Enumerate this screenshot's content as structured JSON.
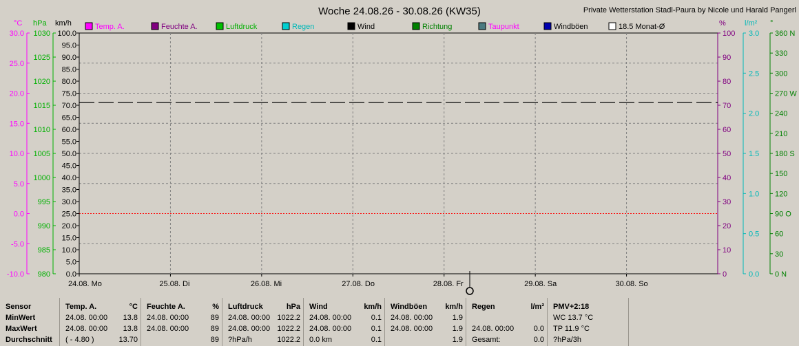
{
  "title": "Woche 24.08.26 - 30.08.26 (KW35)",
  "station": "Private Wetterstation Stadl-Paura by Nicole und Harald Pangerl",
  "legend": [
    {
      "label": "Temp. A.",
      "box": "#ff00ff",
      "text": "#ff00ff"
    },
    {
      "label": "Feuchte A.",
      "box": "#800080",
      "text": "#800080"
    },
    {
      "label": "Luftdruck",
      "box": "#00c000",
      "text": "#00b000"
    },
    {
      "label": "Regen",
      "box": "#00d0d0",
      "text": "#00b8b8"
    },
    {
      "label": "Wind",
      "box": "#000000",
      "text": "#000000"
    },
    {
      "label": "Richtung",
      "box": "#008000",
      "text": "#008000"
    },
    {
      "label": "Taupunkt",
      "box": "#4c7a80",
      "text": "#ff00ff"
    },
    {
      "label": "Windböen",
      "box": "#0000b0",
      "text": "#000000"
    },
    {
      "label": "18.5 Monat-Ø",
      "box": "#ffffff",
      "text": "#000000"
    }
  ],
  "axis_units": {
    "temp": "°C",
    "pressure": "hPa",
    "wind": "km/h",
    "humidity": "%",
    "rain": "l/m²",
    "direction": "°"
  },
  "axes": {
    "temp": [
      "30.0",
      "25.0",
      "20.0",
      "15.0",
      "10.0",
      "5.0",
      "0.0",
      "-5.0",
      "-10.0"
    ],
    "pressure": [
      "1030",
      "1025",
      "1020",
      "1015",
      "1010",
      "1005",
      "1000",
      "995",
      "990",
      "985",
      "980"
    ],
    "wind": [
      "100.0",
      "95.0",
      "90.0",
      "85.0",
      "80.0",
      "75.0",
      "70.0",
      "65.0",
      "60.0",
      "55.0",
      "50.0",
      "45.0",
      "40.0",
      "35.0",
      "30.0",
      "25.0",
      "20.0",
      "15.0",
      "10.0",
      "5.0",
      "0.0"
    ],
    "humidity": [
      "100",
      "90",
      "80",
      "70",
      "60",
      "50",
      "40",
      "30",
      "20",
      "10",
      "0"
    ],
    "rain": [
      "3.0",
      "2.5",
      "2.0",
      "1.5",
      "1.0",
      "0.5",
      "0.0"
    ],
    "direction": [
      "360 N",
      "330",
      "300",
      "270 W",
      "240",
      "210",
      "180 S",
      "150",
      "120",
      "90 O",
      "60",
      "30",
      "0  N"
    ]
  },
  "days": [
    "24.08.  Mo",
    "25.08.  Di",
    "26.08.  Mi",
    "27.08.  Do",
    "28.08.  Fr",
    "29.08.  Sa",
    "30.08.  So"
  ],
  "colors": {
    "temp": "#ff00ff",
    "pressure": "#00b000",
    "humidity": "#800080",
    "rain": "#00b8b8",
    "direction": "#008000",
    "zero_line": "#ff0000"
  },
  "chart_data": {
    "type": "line",
    "title": "Woche 24.08.26 - 30.08.26 (KW35)",
    "x": [
      "24.08.",
      "25.08.",
      "26.08.",
      "27.08.",
      "28.08.",
      "29.08.",
      "30.08."
    ],
    "ylim_temp": [
      -10,
      30
    ],
    "ylim_pressure": [
      980,
      1030
    ],
    "ylim_wind": [
      0,
      100
    ],
    "ylim_humidity": [
      0,
      100
    ],
    "ylim_rain": [
      0,
      3
    ],
    "ylim_direction": [
      0,
      360
    ],
    "grid": true,
    "series": [
      {
        "name": "18.5 Monat-Ø",
        "axis": "temp",
        "values": [
          18.5,
          18.5,
          18.5,
          18.5,
          18.5,
          18.5,
          18.5,
          18.5
        ],
        "style": "dashed"
      }
    ],
    "zero_line_temp": 0
  },
  "stats": {
    "sensor": {
      "h": "Sensor",
      "min": "MinWert",
      "max": "MaxWert",
      "avg": "Durchschnitt"
    },
    "temp": {
      "h": "Temp. A.",
      "u": "°C",
      "min_t": "24.08.  00:00",
      "min_v": "13.8",
      "max_t": "24.08.  00:00",
      "max_v": "13.8",
      "avg_t": "( - 4.80 )",
      "avg_v": "13.70"
    },
    "hum": {
      "h": "Feuchte A.",
      "u": "%",
      "min_t": "24.08.  00:00",
      "min_v": "89",
      "max_t": "24.08.  00:00",
      "max_v": "89",
      "avg_t": "",
      "avg_v": "89"
    },
    "press": {
      "h": "Luftdruck",
      "u": "hPa",
      "min_t": "24.08.  00:00",
      "min_v": "1022.2",
      "max_t": "24.08.  00:00",
      "max_v": "1022.2",
      "avg_t": "?hPa/h",
      "avg_v": "1022.2"
    },
    "wind": {
      "h": "Wind",
      "u": "km/h",
      "min_t": "24.08.  00:00",
      "min_v": "0.1",
      "max_t": "24.08.  00:00",
      "max_v": "0.1",
      "avg_t": "0.0 km",
      "avg_v": "0.1"
    },
    "gust": {
      "h": "Windböen",
      "u": "km/h",
      "min_t": "24.08.  00:00",
      "min_v": "1.9",
      "max_t": "24.08.  00:00",
      "max_v": "1.9",
      "avg_t": "",
      "avg_v": "1.9"
    },
    "rain": {
      "h": "Regen",
      "u": "l/m²",
      "min_t": "",
      "min_v": "",
      "max_t": "24.08.  00:00",
      "max_v": "0.0",
      "avg_t": "Gesamt:",
      "avg_v": "0.0"
    },
    "pmv": {
      "h": "PMV+2:18",
      "min": "WC 13.7 °C",
      "max": "TP 11.9 °C",
      "avg": "?hPa/3h"
    }
  }
}
